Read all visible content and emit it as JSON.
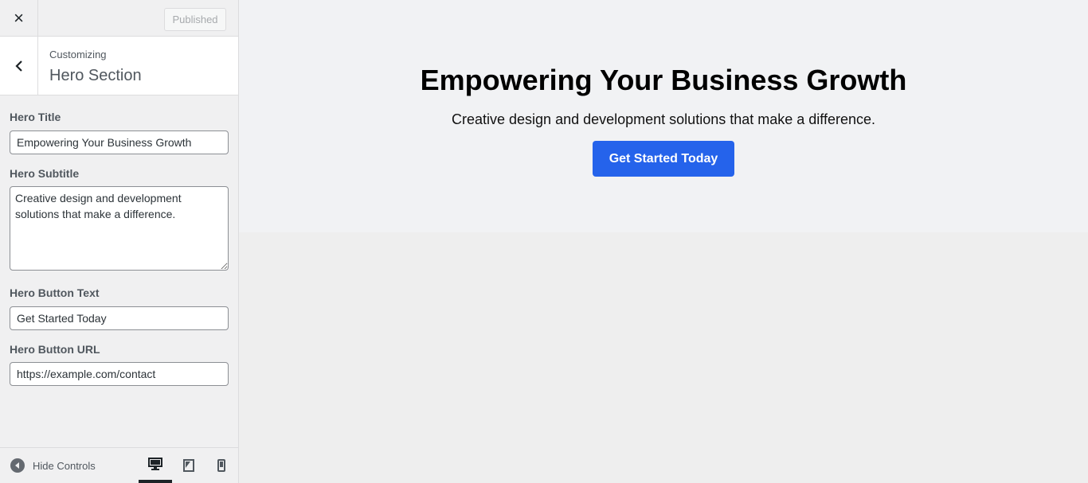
{
  "topbar": {
    "close_icon": "×",
    "published_label": "Published"
  },
  "section": {
    "customizing_label": "Customizing",
    "title": "Hero Section"
  },
  "controls": {
    "hero_title": {
      "label": "Hero Title",
      "value": "Empowering Your Business Growth"
    },
    "hero_subtitle": {
      "label": "Hero Subtitle",
      "value": "Creative design and development solutions that make a difference."
    },
    "hero_button_text": {
      "label": "Hero Button Text",
      "value": "Get Started Today"
    },
    "hero_button_url": {
      "label": "Hero Button URL",
      "value": "https://example.com/contact"
    }
  },
  "footer": {
    "hide_controls_label": "Hide Controls",
    "devices": [
      "desktop-icon",
      "tablet-icon",
      "mobile-icon"
    ],
    "active_device": "desktop"
  },
  "preview": {
    "hero_title": "Empowering Your Business Growth",
    "hero_subtitle": "Creative design and development solutions that make a difference.",
    "hero_button": "Get Started Today",
    "button_color": "#2563eb",
    "hero_bg": "#f1f2f4"
  }
}
